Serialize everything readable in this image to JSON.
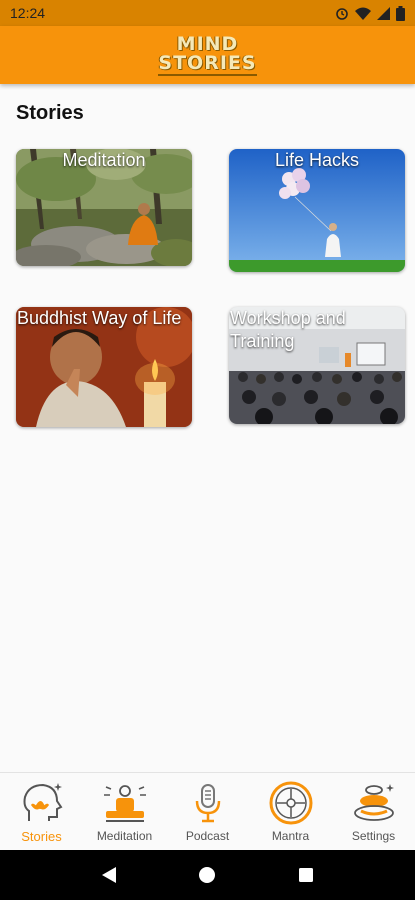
{
  "status_bar": {
    "time": "12:24"
  },
  "app_bar": {
    "logo_line1": "MIND",
    "logo_line2": "STORIES"
  },
  "section": {
    "title": "Stories"
  },
  "cards": [
    {
      "title": "Meditation"
    },
    {
      "title": "Life Hacks"
    },
    {
      "title": "Buddhist Way of Life"
    },
    {
      "title": "Workshop and Training"
    }
  ],
  "bottom_nav": {
    "items": [
      {
        "label": "Stories",
        "icon": "head-lotus-icon",
        "active": true
      },
      {
        "label": "Meditation",
        "icon": "meditating-figure-icon",
        "active": false
      },
      {
        "label": "Podcast",
        "icon": "microphone-icon",
        "active": false
      },
      {
        "label": "Mantra",
        "icon": "mantra-wheel-icon",
        "active": false
      },
      {
        "label": "Settings",
        "icon": "stacked-stones-icon",
        "active": false
      }
    ]
  },
  "colors": {
    "status_bar": "#d98300",
    "app_bar": "#f7930b",
    "accent": "#f7930b"
  }
}
